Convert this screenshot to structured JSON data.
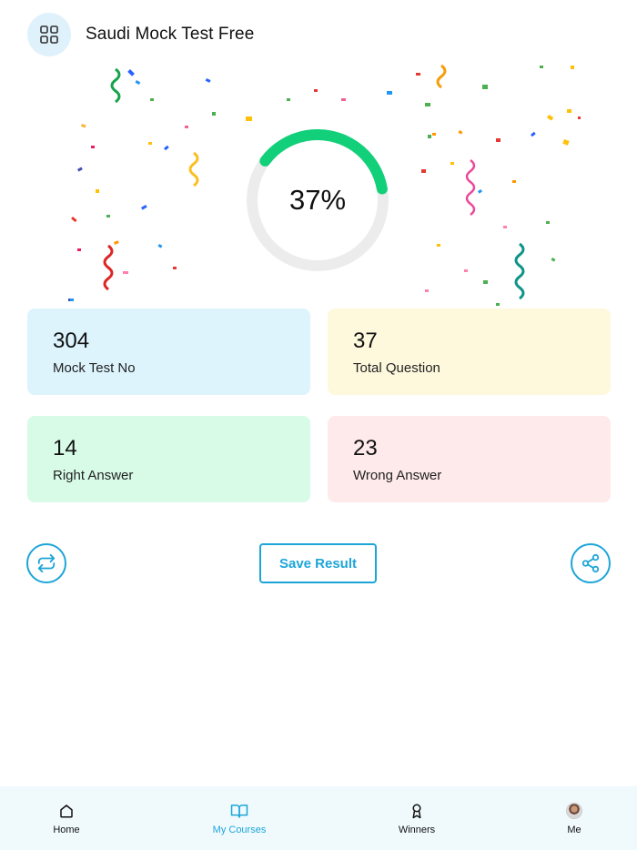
{
  "header": {
    "title": "Saudi Mock Test Free",
    "menu_icon": "grid-icon"
  },
  "score": {
    "percent_label": "37%",
    "percent_value": 37,
    "progress_color": "#12d07a",
    "track_color": "#ececec"
  },
  "stats": [
    {
      "value": "304",
      "label": "Mock Test No",
      "bg": "#ddf4fd"
    },
    {
      "value": "37",
      "label": "Total Question",
      "bg": "#fef9dd"
    },
    {
      "value": "14",
      "label": "Right Answer",
      "bg": "#d8fbe7"
    },
    {
      "value": "23",
      "label": "Wrong Answer",
      "bg": "#feeaeb"
    }
  ],
  "actions": {
    "retry_icon": "repeat-icon",
    "save_label": "Save Result",
    "share_icon": "share-icon",
    "accent": "#1ea5d8"
  },
  "nav": {
    "items": [
      {
        "label": "Home",
        "icon": "home-icon",
        "active": false
      },
      {
        "label": "My Courses",
        "icon": "book-icon",
        "active": true
      },
      {
        "label": "Winners",
        "icon": "award-icon",
        "active": false
      },
      {
        "label": "Me",
        "icon": "avatar",
        "active": false
      }
    ]
  }
}
